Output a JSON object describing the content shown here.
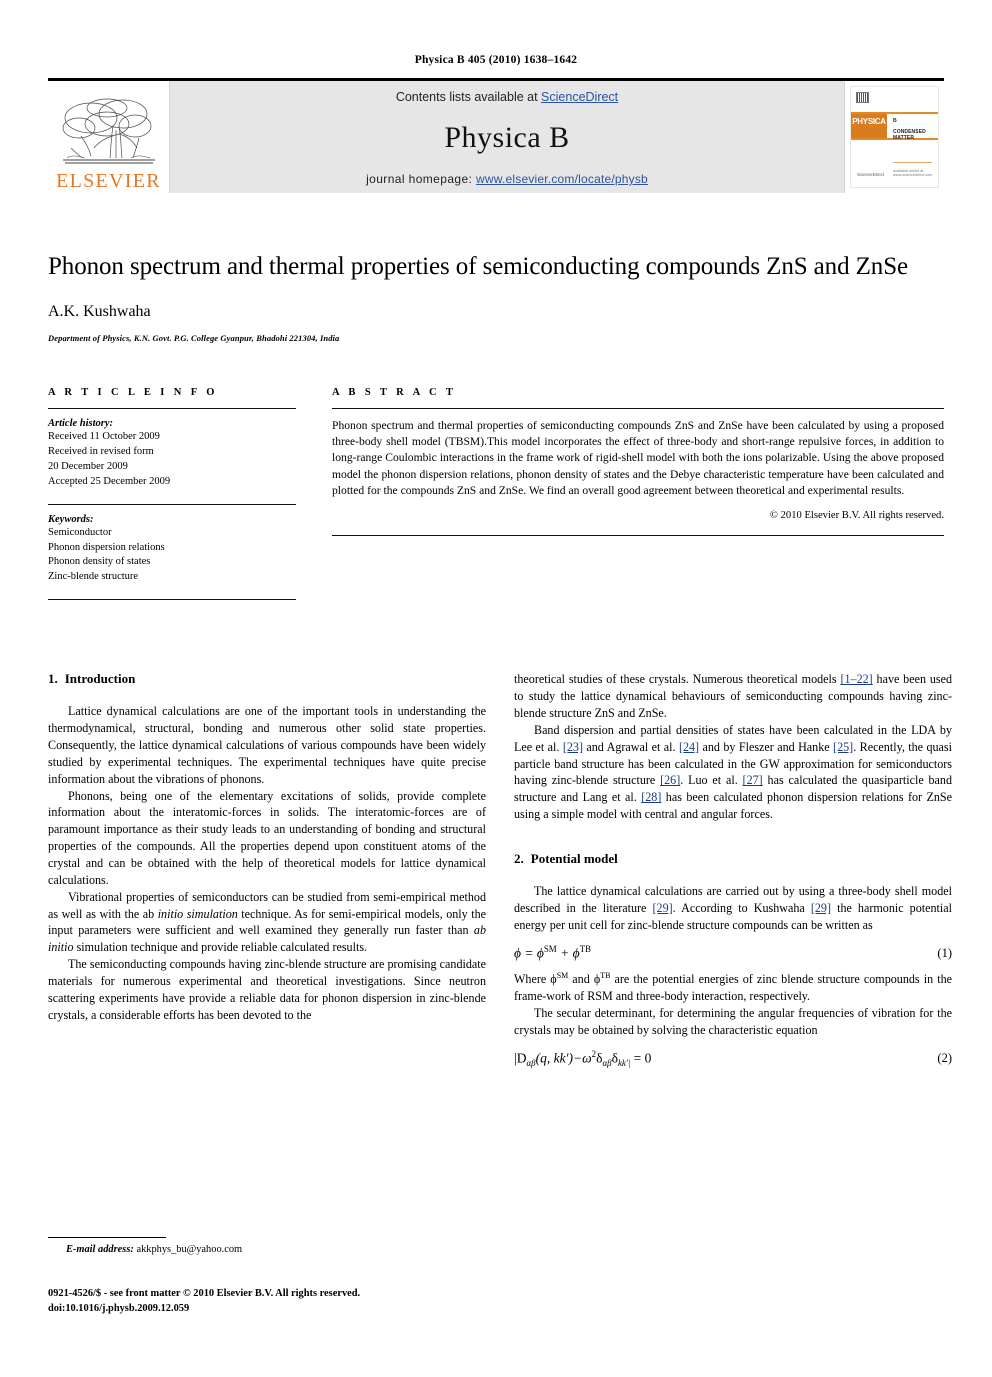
{
  "running_head": "Physica B 405 (2010) 1638–1642",
  "banner": {
    "publisher_logo_text": "ELSEVIER",
    "contents_prefix": "Contents lists available at ",
    "sciencedirect": "ScienceDirect",
    "journal_name": "Physica B",
    "homepage_prefix": "journal homepage: ",
    "homepage_url": "www.elsevier.com/locate/physb",
    "cover": {
      "brand": "PHYSICA",
      "volume_mark": "B",
      "subtitle": "CONDENSED MATTER",
      "sd_logo": "ScienceDirect",
      "footer_note": "available online at www.sciencedirect.com"
    },
    "link_color": "#2b53a0",
    "accent_color": "#E87722"
  },
  "article": {
    "title": "Phonon spectrum and thermal properties of semiconducting compounds ZnS and ZnSe",
    "author": "A.K. Kushwaha",
    "affiliation": "Department of Physics, K.N. Govt. P.G. College Gyanpur, Bhadohi 221304, India"
  },
  "article_info": {
    "heading": "A R T I C L E   I N F O",
    "history_label": "Article history:",
    "history": [
      "Received 11 October 2009",
      "Received in revised form",
      "20 December 2009",
      "Accepted 25 December 2009"
    ],
    "keywords_label": "Keywords:",
    "keywords": [
      "Semiconductor",
      "Phonon dispersion relations",
      "Phonon density of states",
      "Zinc-blende structure"
    ]
  },
  "abstract": {
    "heading": "A B S T R A C T",
    "text": "Phonon spectrum and thermal properties of semiconducting compounds ZnS and ZnSe have been calculated by using a proposed three-body shell model (TBSM).This model incorporates the effect of three-body and short-range repulsive forces, in addition to long-range Coulombic interactions in the frame work of rigid-shell model with both the ions polarizable. Using the above proposed model the phonon dispersion relations, phonon density of states and the Debye characteristic temperature have been calculated and plotted for the compounds ZnS and ZnSe. We find an overall good agreement between theoretical and experimental results.",
    "copyright": "© 2010 Elsevier B.V. All rights reserved."
  },
  "sections": {
    "introduction": {
      "number": "1.",
      "title": "Introduction",
      "paragraphs": [
        "Lattice dynamical calculations are one of the important tools in understanding the thermodynamical, structural, bonding and numerous other solid state properties. Consequently, the lattice dynamical calculations of various compounds have been widely studied by experimental techniques. The experimental techniques have quite precise information about the vibrations of phonons.",
        "Phonons, being one of the elementary excitations of solids, provide complete information about the interatomic-forces in solids. The interatomic-forces are of paramount importance as their study leads to an understanding of bonding and structural properties of the compounds. All the properties depend upon constituent atoms of the crystal and can be obtained with the help of theoretical models for lattice dynamical calculations."
      ],
      "para3_a": "Vibrational properties of semiconductors can be studied from semi-empirical method as well as with the ab ",
      "para3_ital1": "initio simulation",
      "para3_b": " technique. As for semi-empirical models, only the input parameters were sufficient and well examined they generally run faster than ",
      "para3_ital2": "ab initio",
      "para3_c": " simulation technique and provide reliable calculated results.",
      "para4": "The semiconducting compounds having zinc-blende structure are promising candidate materials for numerous experimental and theoretical investigations. Since neutron scattering experiments have provide a reliable data for phonon dispersion in zinc-blende crystals, a considerable efforts has been devoted to the",
      "para5_a": "theoretical studies of these crystals. Numerous theoretical models ",
      "para5_ref1": "[1–22]",
      "para5_b": " have been used to study the lattice dynamical behaviours of semiconducting compounds having zinc-blende structure ZnS and ZnSe.",
      "para6_a": "Band dispersion and partial densities of states have been calculated in the LDA by Lee et al. ",
      "para6_ref1": "[23]",
      "para6_b": " and Agrawal et al. ",
      "para6_ref2": "[24]",
      "para6_c": " and by Fleszer and Hanke ",
      "para6_ref3": "[25]",
      "para6_d": ". Recently, the quasi particle band structure has been calculated in the GW approximation for semiconductors having zinc-blende structure ",
      "para6_ref4": "[26]",
      "para6_e": ". Luo et al. ",
      "para6_ref5": "[27]",
      "para6_f": " has calculated the quasiparticle band structure and Lang et al. ",
      "para6_ref6": "[28]",
      "para6_g": " has been calculated phonon dispersion relations for ZnSe using a simple model with central and angular forces."
    },
    "potential_model": {
      "number": "2.",
      "title": "Potential model",
      "para1_a": "The lattice dynamical calculations are carried out by using a three-body shell model described in the literature ",
      "para1_ref1": "[29]",
      "para1_b": ". According to Kushwaha ",
      "para1_ref2": "[29]",
      "para1_c": " the harmonic potential energy per unit cell for zinc-blende structure compounds can be written as",
      "equation1": "ϕ = ϕ",
      "equation1_sup1": "SM",
      "equation1_mid": " + ϕ",
      "equation1_sup2": "TB",
      "equation1_number": "(1)",
      "para2_a": "Where  ϕ",
      "para2_sup1": "SM",
      "para2_b": "  and  ϕ",
      "para2_sup2": "TB",
      "para2_c": "  are the potential energies of zinc blende structure compounds in the frame-work of RSM and three-body interaction, respectively.",
      "para3": "The secular determinant, for determining the angular frequencies of vibration for the crystals may be obtained by solving the characteristic equation",
      "equation2_p1": "|D",
      "equation2_sub1": "αβ",
      "equation2_p2": "(q, kk′)−ω",
      "equation2_sup1": "2",
      "equation2_p3": "δ",
      "equation2_sub2": "αβ",
      "equation2_p4": "δ",
      "equation2_sub3": "kk′|",
      "equation2_p5": " = 0",
      "equation2_number": "(2)"
    }
  },
  "footnote": {
    "email_label": "E-mail address:",
    "email": "akkphys_bu@yahoo.com"
  },
  "imprint": {
    "line1": "0921-4526/$ - see front matter © 2010 Elsevier B.V. All rights reserved.",
    "line2": "doi:10.1016/j.physb.2009.12.059"
  }
}
